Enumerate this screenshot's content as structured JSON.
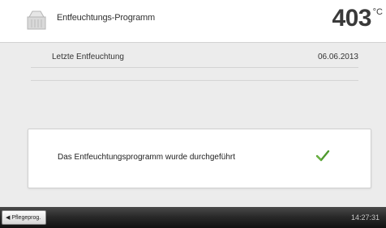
{
  "header": {
    "title": "Entfeuchtungs-Programm",
    "temperature": "403",
    "temperature_unit": "°C",
    "icon": "furnace-icon"
  },
  "info": {
    "last_dehumidification_label": "Letzte Entfeuchtung",
    "last_dehumidification_date": "06.06.2013"
  },
  "message": {
    "text": "Das Entfeuchtungsprogramm wurde durchgeführt",
    "icon": "check-icon",
    "icon_color": "#4f9a2e"
  },
  "footer": {
    "back_label": "Pflegeprog.",
    "back_icon": "chevron-left-icon",
    "time": "14:27:31"
  }
}
